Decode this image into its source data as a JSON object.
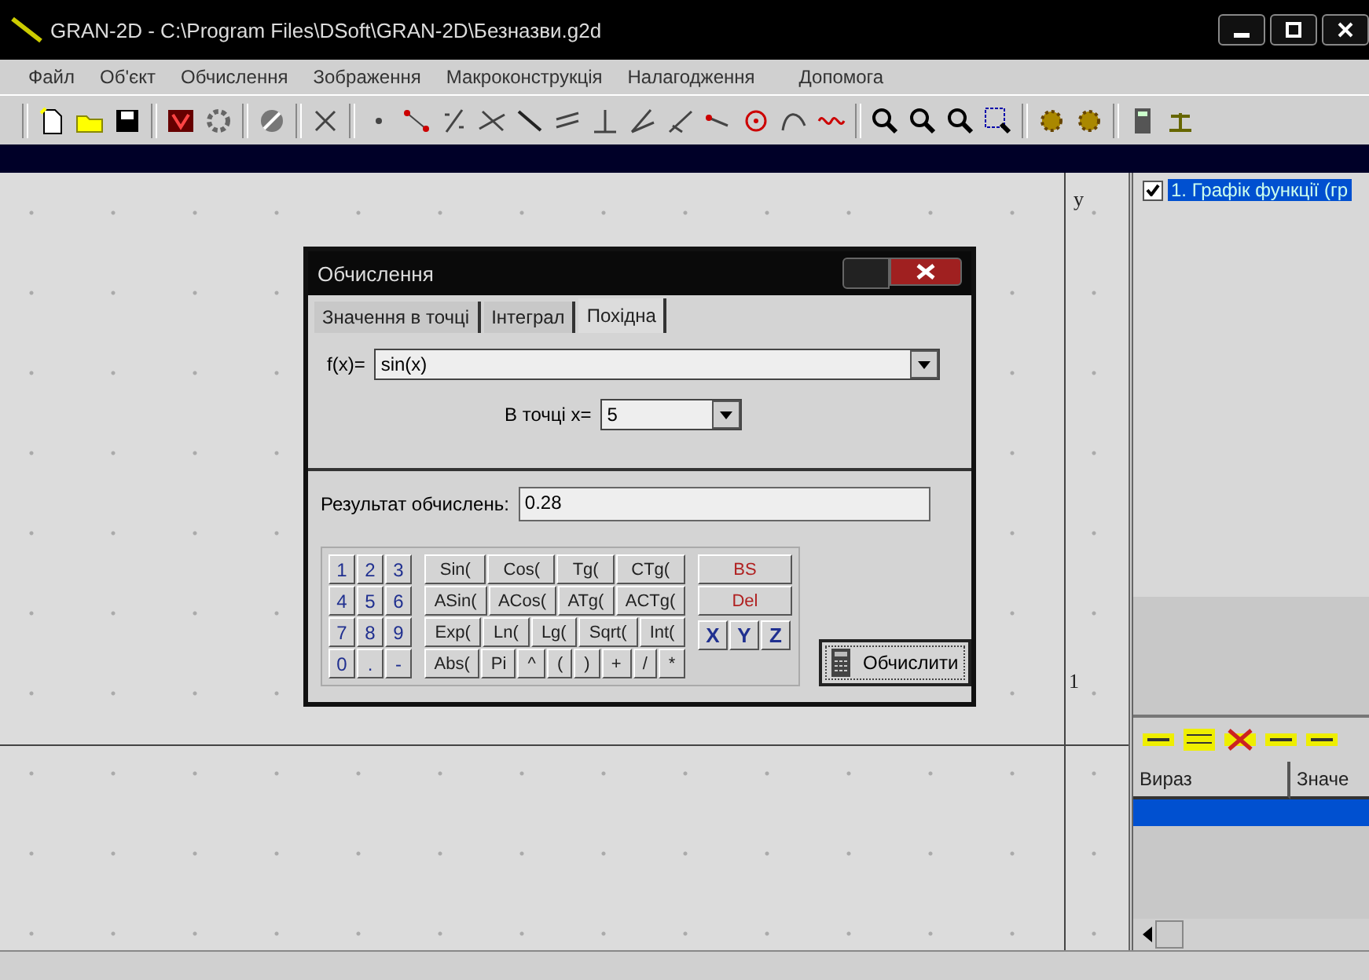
{
  "window": {
    "title": "GRAN-2D - C:\\Program Files\\DSoft\\GRAN-2D\\Безназви.g2d"
  },
  "menu": [
    "Файл",
    "Об'єкт",
    "Обчислення",
    "Зображення",
    "Макроконструкція",
    "Налагодження",
    "Допомога"
  ],
  "plot": {
    "y_axis_label": "y",
    "tick_label": "1"
  },
  "dialog": {
    "title": "Обчислення",
    "tabs": [
      {
        "label": "Значення в точці",
        "selected": false
      },
      {
        "label": "Інтеграл",
        "selected": false
      },
      {
        "label": "Похідна",
        "selected": true
      }
    ],
    "function": {
      "label": "f(x)=",
      "value": "sin(x)"
    },
    "point": {
      "label": "В точці x=",
      "value": "5"
    },
    "result": {
      "label": "Результат обчислень:",
      "value": "0.28"
    },
    "keypad": {
      "digits": [
        [
          "1",
          "2",
          "3"
        ],
        [
          "4",
          "5",
          "6"
        ],
        [
          "7",
          "8",
          "9"
        ],
        [
          "0",
          ".",
          "-"
        ]
      ],
      "functions": [
        [
          "Sin(",
          "Cos(",
          "Tg(",
          "CTg("
        ],
        [
          "ASin(",
          "ACos(",
          "ATg(",
          "ACTg("
        ],
        [
          "Exp(",
          "Ln(",
          "Lg(",
          "Sqrt(",
          "Int("
        ],
        [
          "Abs(",
          "Pi",
          "^",
          "(",
          ")",
          "+",
          "/",
          "*"
        ]
      ],
      "edit_keys": [
        "BS",
        "Del"
      ],
      "variables": [
        "X",
        "Y",
        "Z"
      ]
    },
    "compute_button": "Обчислити"
  },
  "objects": [
    {
      "label": "1. Графік функції (гр",
      "checked": true,
      "selected": true
    }
  ],
  "expressions": {
    "columns": [
      "Вираз",
      "Значе"
    ],
    "rows": [
      {
        "selected": true
      }
    ]
  }
}
